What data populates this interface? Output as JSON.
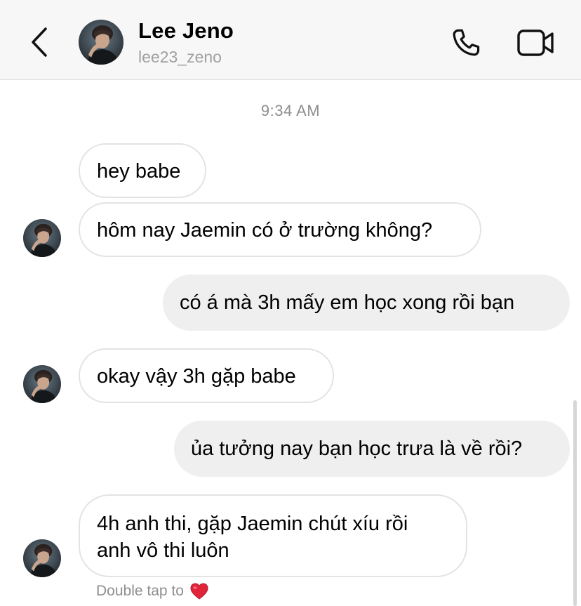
{
  "header": {
    "name": "Lee Jeno",
    "username": "lee23_zeno"
  },
  "conversation": {
    "timestamp": "9:34 AM",
    "messages": [
      {
        "from": "them",
        "text": "hey babe"
      },
      {
        "from": "them",
        "text": "hôm nay Jaemin có ở trường không?"
      },
      {
        "from": "me",
        "text": "có á mà 3h mấy em học xong rồi bạn"
      },
      {
        "from": "them",
        "text": "okay vậy 3h gặp babe"
      },
      {
        "from": "me",
        "text": "ủa tưởng nay bạn học trưa là về rồi?"
      },
      {
        "from": "them",
        "line1": "4h anh thi, gặp Jaemin chút xíu rồi",
        "line2": "anh vô thi luôn"
      }
    ],
    "reaction_hint": "Double tap to"
  },
  "icons": {
    "back": "chevron-left-icon",
    "call": "phone-icon",
    "video": "video-camera-icon",
    "heart": "red-heart-icon"
  },
  "colors": {
    "header_bg": "#f7f7f7",
    "incoming_bubble_border": "#e3e3e3",
    "outgoing_bubble_bg": "#efefef",
    "secondary_text": "#8e8e8e",
    "heart": "#e0243a"
  }
}
